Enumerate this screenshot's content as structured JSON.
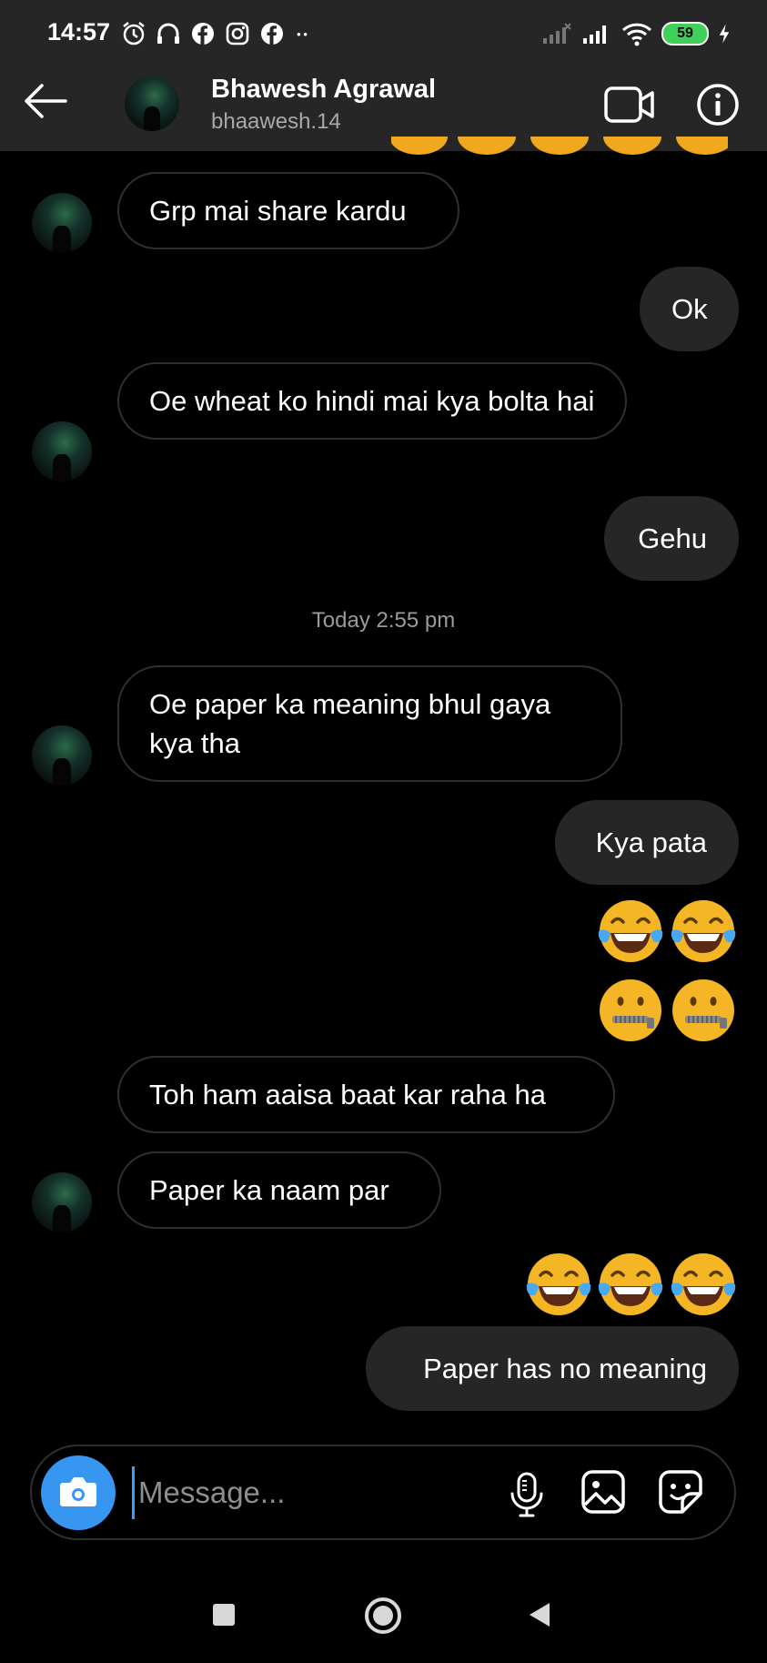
{
  "status_bar": {
    "time": "14:57",
    "battery": "59"
  },
  "header": {
    "name": "Bhawesh Agrawal",
    "username": "bhaawesh.14"
  },
  "messages": [
    {
      "text": "Grp mai share kardu"
    },
    {
      "text": "Ok"
    },
    {
      "text": "Oe wheat ko hindi mai kya bolta hai"
    },
    {
      "text": "Gehu"
    },
    {
      "text": "Oe paper ka meaning bhul gaya kya tha"
    },
    {
      "text": "Kya pata"
    },
    {
      "text": "Toh ham aaisa baat kar raha ha"
    },
    {
      "text": "Paper ka naam par"
    },
    {
      "text": "Paper has no meaning"
    }
  ],
  "timestamp": "Today 2:55 pm",
  "emojis": {
    "row1": [
      "face-with-tears-of-joy",
      "face-with-tears-of-joy"
    ],
    "row2": [
      "zipper-mouth-face",
      "zipper-mouth-face"
    ],
    "row3": [
      "face-with-tears-of-joy",
      "face-with-tears-of-joy",
      "face-with-tears-of-joy"
    ]
  },
  "composer": {
    "placeholder": "Message..."
  },
  "colors": {
    "background": "#000000",
    "bar": "#262626",
    "sent_bubble": "#262626",
    "accent": "#3797f0"
  }
}
